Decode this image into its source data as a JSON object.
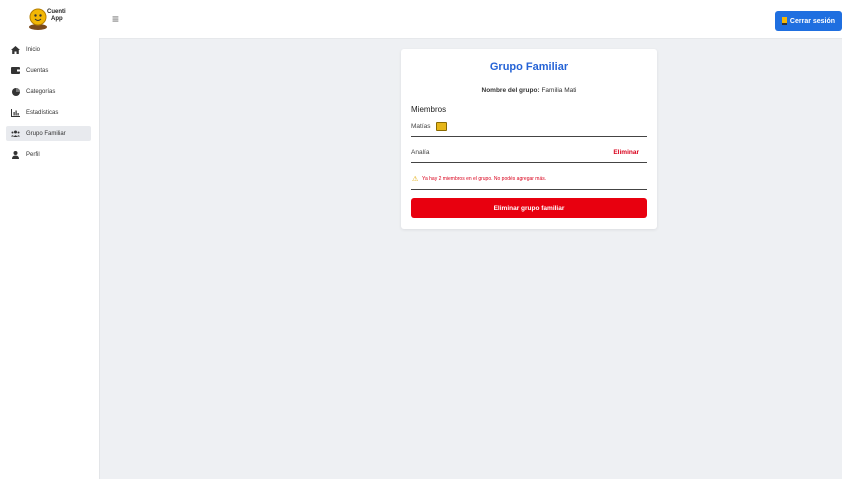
{
  "app": {
    "logo_line1": "Cuenti",
    "logo_line2": "App"
  },
  "header": {
    "menu_icon": "hamburger-icon",
    "logout_label": "Cerrar sesión",
    "logout_icon": "door-icon",
    "accent_color": "#1f6fe0"
  },
  "sidebar": {
    "items": [
      {
        "label": "Inicio",
        "icon": "home-icon",
        "active": false
      },
      {
        "label": "Cuentas",
        "icon": "wallet-icon",
        "active": false
      },
      {
        "label": "Categorías",
        "icon": "pie-chart-icon",
        "active": false
      },
      {
        "label": "Estadísticas",
        "icon": "bar-chart-icon",
        "active": false
      },
      {
        "label": "Grupo Familiar",
        "icon": "users-icon",
        "active": true
      },
      {
        "label": "Perfil",
        "icon": "user-icon",
        "active": false
      }
    ]
  },
  "main": {
    "title": "Grupo Familiar",
    "group_name_label": "Nombre del grupo:",
    "group_name_value": "Familia Mati",
    "members_heading": "Miembros",
    "members": [
      {
        "name": "Matías",
        "is_owner": true,
        "action": ""
      },
      {
        "name": "Analía",
        "is_owner": false,
        "action": "Eliminar"
      }
    ],
    "warning_text": "Ya hay 2 miembros en el grupo. No podés agregar más.",
    "delete_group_label": "Eliminar grupo familiar",
    "danger_color": "#e8000f"
  }
}
